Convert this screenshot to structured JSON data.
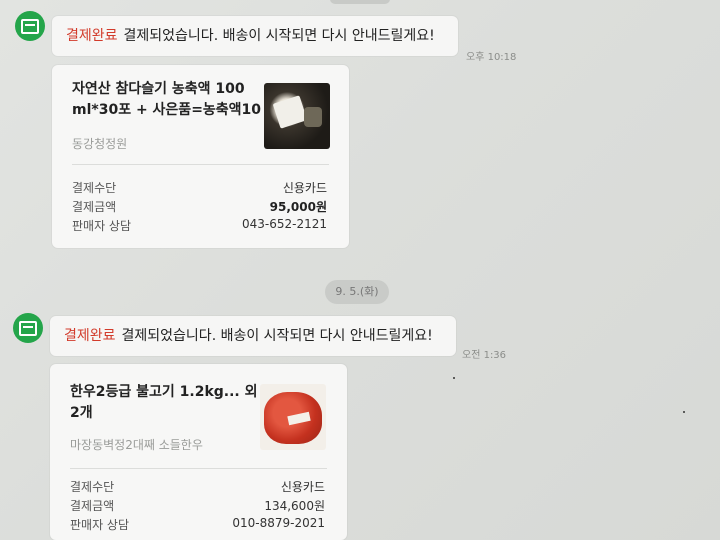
{
  "messages": [
    {
      "tag": "결제완료",
      "text": "결제되었습니다. 배송이 시작되면 다시 안내드릴게요!",
      "time": "오후 10:18",
      "card": {
        "title_line1": "자연산 참다슬기 농축액 100",
        "title_line2": "ml*30포 + 사은품=농축액10",
        "seller": "동강청정원",
        "thumb_icon": "product-thumbnail-extract-box",
        "rows": [
          {
            "label": "결제수단",
            "value": "신용카드"
          },
          {
            "label": "결제금액",
            "value": "95,000원"
          },
          {
            "label": "판매자 상담",
            "value": "043-652-2121"
          }
        ]
      }
    },
    {
      "tag": "결제완료",
      "text": "결제되었습니다. 배송이 시작되면 다시 안내드릴게요!",
      "time": "오전 1:36",
      "card": {
        "title_line1": "한우2등급 불고기 1.2kg... 외",
        "title_line2": "2개",
        "seller": "마장동벽정2대째 소들한우",
        "thumb_icon": "product-thumbnail-bulgogi",
        "rows": [
          {
            "label": "결제수단",
            "value": "신용카드"
          },
          {
            "label": "결제금액",
            "value": "134,600원"
          },
          {
            "label": "판매자 상담",
            "value": "010-8879-2021"
          }
        ]
      }
    }
  ],
  "date_divider": "9. 5.(화)",
  "colors": {
    "accent_red": "#d23b2b",
    "avatar_green": "#24a54a",
    "background": "#dcdedb"
  }
}
